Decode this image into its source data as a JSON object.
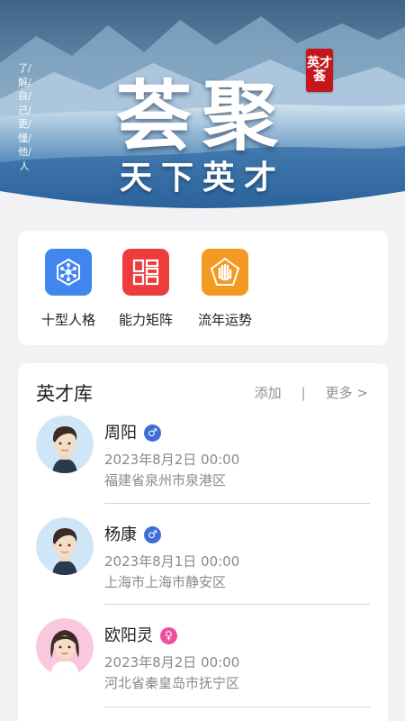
{
  "banner": {
    "title": "荟聚",
    "subtitle": "天下英才",
    "vertical_text": "了/解/自/己/更/懂/他/人",
    "seal_line1": "英才",
    "seal_line2": "荟"
  },
  "tools": [
    {
      "label": "十型人格",
      "icon": "network-icon",
      "color": "#3f86ee"
    },
    {
      "label": "能力矩阵",
      "icon": "grid-icon",
      "color": "#ee3b3b"
    },
    {
      "label": "流年运势",
      "icon": "palm-icon",
      "color": "#f49a22"
    }
  ],
  "talent": {
    "title": "英才库",
    "add_label": "添加",
    "separator": "|",
    "more_label": "更多 >",
    "people": [
      {
        "name": "周阳",
        "gender": "male",
        "gender_symbol": "♂",
        "date": "2023年8月2日 00:00",
        "address": "福建省泉州市泉港区"
      },
      {
        "name": "杨康",
        "gender": "male",
        "gender_symbol": "♂",
        "date": "2023年8月1日 00:00",
        "address": "上海市上海市静安区"
      },
      {
        "name": "欧阳灵",
        "gender": "female",
        "gender_symbol": "♀",
        "date": "2023年8月2日 00:00",
        "address": "河北省秦皇岛市抚宁区"
      }
    ]
  },
  "colors": {
    "male": "#3e6fd6",
    "female": "#ee4fa0",
    "seal": "#c4161c"
  }
}
